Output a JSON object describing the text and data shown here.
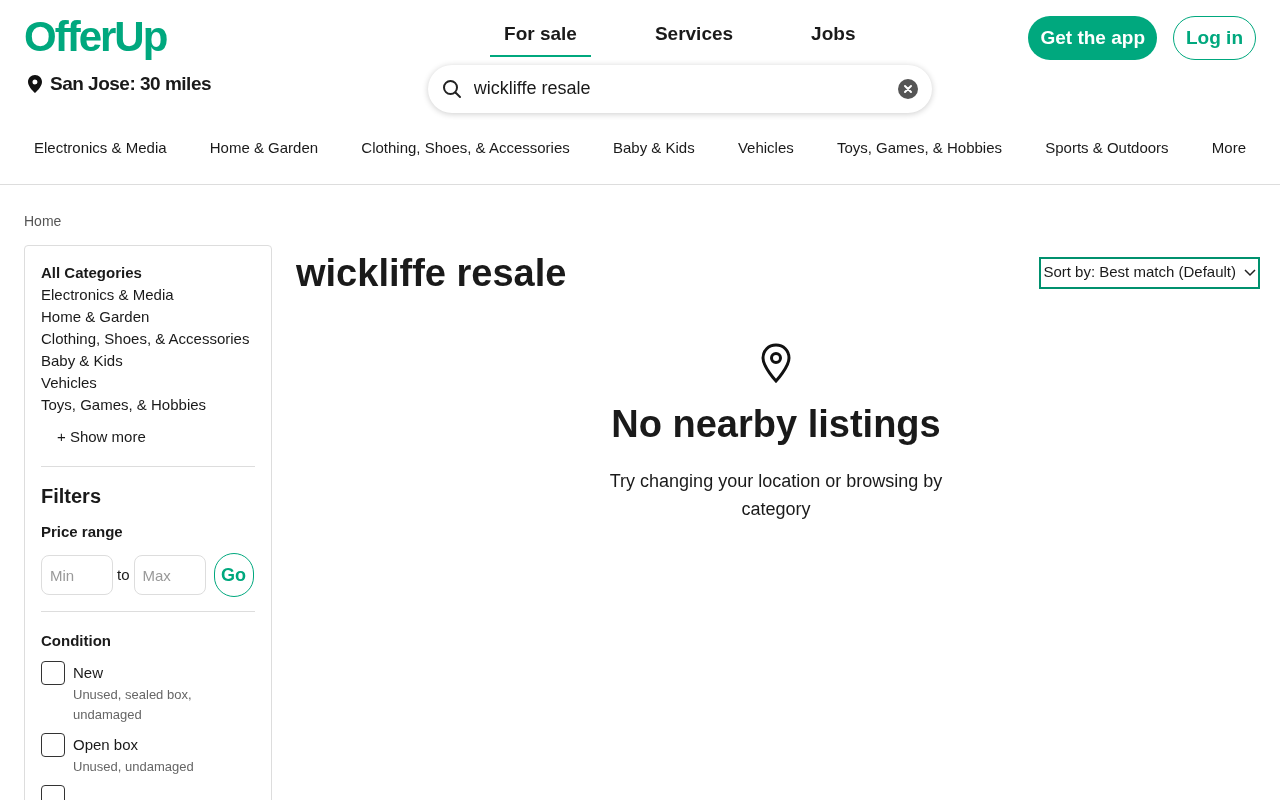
{
  "logo": "OfferUp",
  "location": "San Jose: 30 miles",
  "top_tabs": [
    {
      "label": "For sale",
      "selected": true
    },
    {
      "label": "Services",
      "selected": false
    },
    {
      "label": "Jobs",
      "selected": false
    }
  ],
  "search": {
    "value": "wickliffe resale"
  },
  "buttons": {
    "get_app": "Get the app",
    "login": "Log in"
  },
  "category_nav": [
    "Electronics & Media",
    "Home & Garden",
    "Clothing, Shoes, & Accessories",
    "Baby & Kids",
    "Vehicles",
    "Toys, Games, & Hobbies",
    "Sports & Outdoors",
    "More"
  ],
  "breadcrumb": "Home",
  "sidebar": {
    "categories_title": "All Categories",
    "categories": [
      "Electronics & Media",
      "Home & Garden",
      "Clothing, Shoes, & Accessories",
      "Baby & Kids",
      "Vehicles",
      "Toys, Games, & Hobbies"
    ],
    "show_more": "+ Show more",
    "filters_title": "Filters",
    "price_label": "Price range",
    "min_placeholder": "Min",
    "to": "to",
    "max_placeholder": "Max",
    "go": "Go",
    "condition_label": "Condition",
    "conditions": [
      {
        "label": "New",
        "hint": "Unused, sealed box, undamaged",
        "checked": false
      },
      {
        "label": "Open box",
        "hint": "Unused, undamaged",
        "checked": false
      },
      {
        "checked": false
      }
    ]
  },
  "results": {
    "title": "wickliffe resale",
    "sort": "Sort by: Best match (Default)",
    "empty_title": "No nearby listings",
    "empty_text": "Try changing your location or browsing by category"
  }
}
